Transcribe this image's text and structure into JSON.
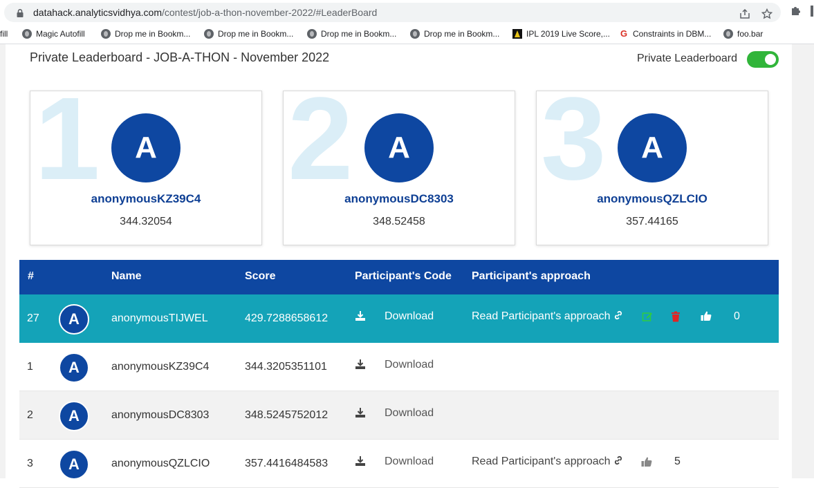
{
  "browser": {
    "url_host": "datahack.analyticsvidhya.com",
    "url_path": "/contest/job-a-thon-november-2022/#LeaderBoard",
    "bookmarks": [
      {
        "label": "fill",
        "icon": "none"
      },
      {
        "label": "Magic Autofill",
        "icon": "globe-icon"
      },
      {
        "label": "Drop me in Bookm...",
        "icon": "globe-icon"
      },
      {
        "label": "Drop me in Bookm...",
        "icon": "globe-icon"
      },
      {
        "label": "Drop me in Bookm...",
        "icon": "globe-icon"
      },
      {
        "label": "Drop me in Bookm...",
        "icon": "globe-icon"
      },
      {
        "label": "IPL 2019 Live Score,...",
        "icon": "ipl-icon"
      },
      {
        "label": "Constraints in DBM...",
        "icon": "g-icon"
      },
      {
        "label": "foo.bar",
        "icon": "globe-icon"
      }
    ]
  },
  "leaderboard": {
    "title": "Private Leaderboard - JOB-A-THON - November 2022",
    "toggle_label": "Private Leaderboard",
    "toggle_on": true,
    "accent": "#0e47a1",
    "highlight": "#14a3b8"
  },
  "podium": [
    {
      "rank": "1",
      "avatar": "A",
      "name": "anonymousKZ39C4",
      "score": "344.32054"
    },
    {
      "rank": "2",
      "avatar": "A",
      "name": "anonymousDC8303",
      "score": "348.52458"
    },
    {
      "rank": "3",
      "avatar": "A",
      "name": "anonymousQZLCIO",
      "score": "357.44165"
    }
  ],
  "table": {
    "headers": {
      "rank": "#",
      "name": "Name",
      "score": "Score",
      "code": "Participant's Code",
      "approach": "Participant's approach"
    },
    "rows": [
      {
        "rank": "27",
        "avatar": "A",
        "name": "anonymousTIJWEL",
        "score": "429.7288658612",
        "download": "Download",
        "approach": "Read Participant's approach",
        "likes": "0",
        "own": true
      },
      {
        "rank": "1",
        "avatar": "A",
        "name": "anonymousKZ39C4",
        "score": "344.3205351101",
        "download": "Download",
        "approach": "",
        "likes": ""
      },
      {
        "rank": "2",
        "avatar": "A",
        "name": "anonymousDC8303",
        "score": "348.5245752012",
        "download": "Download",
        "approach": "",
        "likes": ""
      },
      {
        "rank": "3",
        "avatar": "A",
        "name": "anonymousQZLCIO",
        "score": "357.4416484583",
        "download": "Download",
        "approach": "Read Participant's approach",
        "likes": "5"
      }
    ]
  }
}
